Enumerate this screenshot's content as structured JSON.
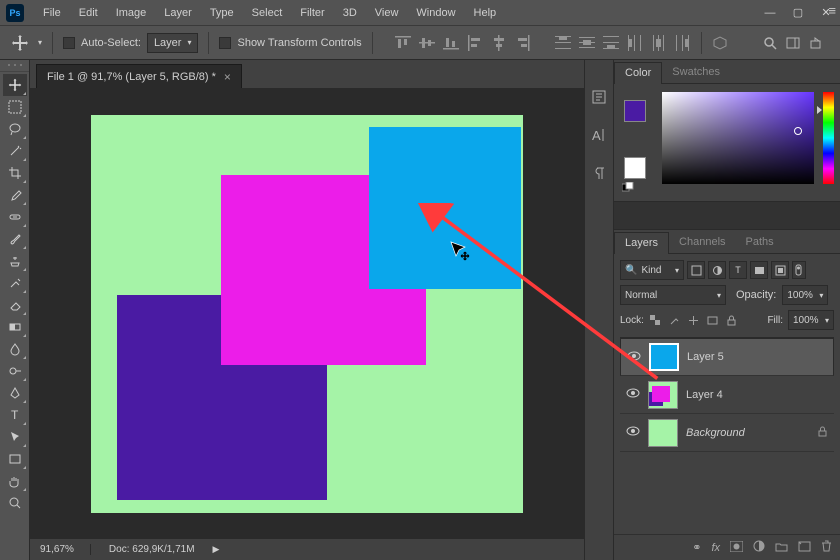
{
  "menubar": [
    "File",
    "Edit",
    "Image",
    "Layer",
    "Type",
    "Select",
    "Filter",
    "3D",
    "View",
    "Window",
    "Help"
  ],
  "optbar": {
    "auto_select": "Auto-Select:",
    "target": "Layer",
    "show_transform": "Show Transform Controls"
  },
  "tab": {
    "title": "File 1 @ 91,7% (Layer 5, RGB/8) *"
  },
  "status": {
    "zoom": "91,67%",
    "doc": "Doc: 629,9K/1,71M"
  },
  "panels": {
    "color": "Color",
    "swatches": "Swatches",
    "layers": "Layers",
    "channels": "Channels",
    "paths": "Paths"
  },
  "layers": {
    "kind_label": "Kind",
    "blend": "Normal",
    "opacity_label": "Opacity:",
    "opacity_val": "100%",
    "lock_label": "Lock:",
    "fill_label": "Fill:",
    "fill_val": "100%",
    "items": [
      {
        "name": "Layer 5"
      },
      {
        "name": "Layer 4"
      },
      {
        "name": "Background"
      }
    ]
  },
  "colors": {
    "fg": "#4a1ba3",
    "bg": "#ffffff"
  }
}
